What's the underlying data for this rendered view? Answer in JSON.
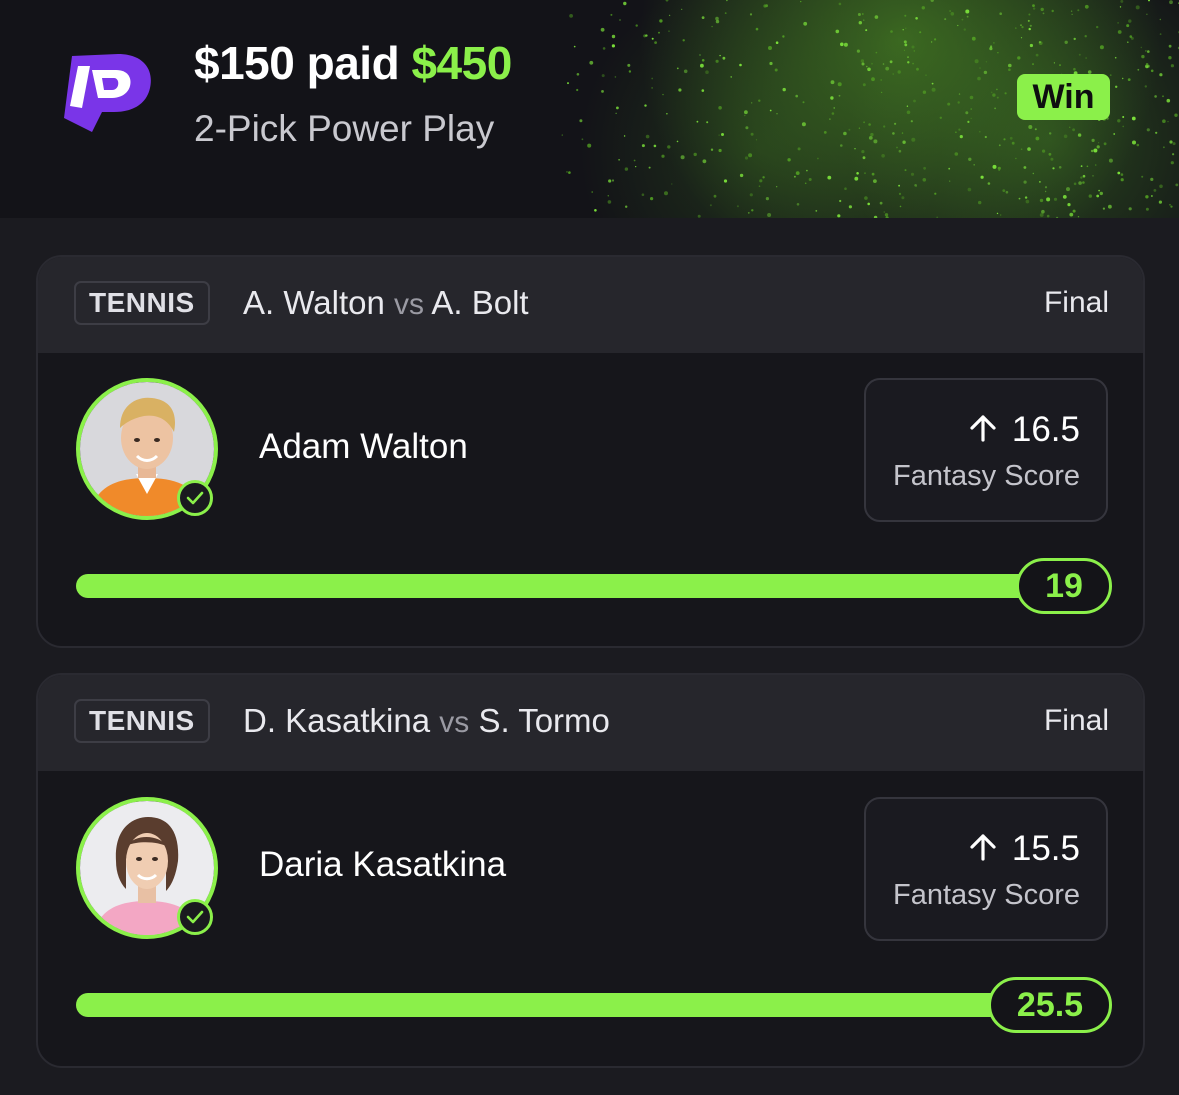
{
  "header": {
    "entry_amount": "$150",
    "paid_word": "paid",
    "payout_amount": "$450",
    "play_type": "2-Pick Power Play",
    "result_badge": "Win"
  },
  "picks": [
    {
      "sport": "TENNIS",
      "team_a": "A. Walton",
      "vs": "vs",
      "team_b": "A. Bolt",
      "status": "Final",
      "player": "Adam Walton",
      "direction": "more-arrow-icon",
      "line": "16.5",
      "stat": "Fantasy Score",
      "result": "19",
      "progress": 1.0
    },
    {
      "sport": "TENNIS",
      "team_a": "D. Kasatkina",
      "vs": "vs",
      "team_b": "S. Tormo",
      "status": "Final",
      "player": "Daria Kasatkina",
      "direction": "more-arrow-icon",
      "line": "15.5",
      "stat": "Fantasy Score",
      "result": "25.5",
      "progress": 1.0
    }
  ],
  "colors": {
    "accent": "#8bf04a",
    "logo": "#7a35e8",
    "background": "#1b1b20"
  }
}
